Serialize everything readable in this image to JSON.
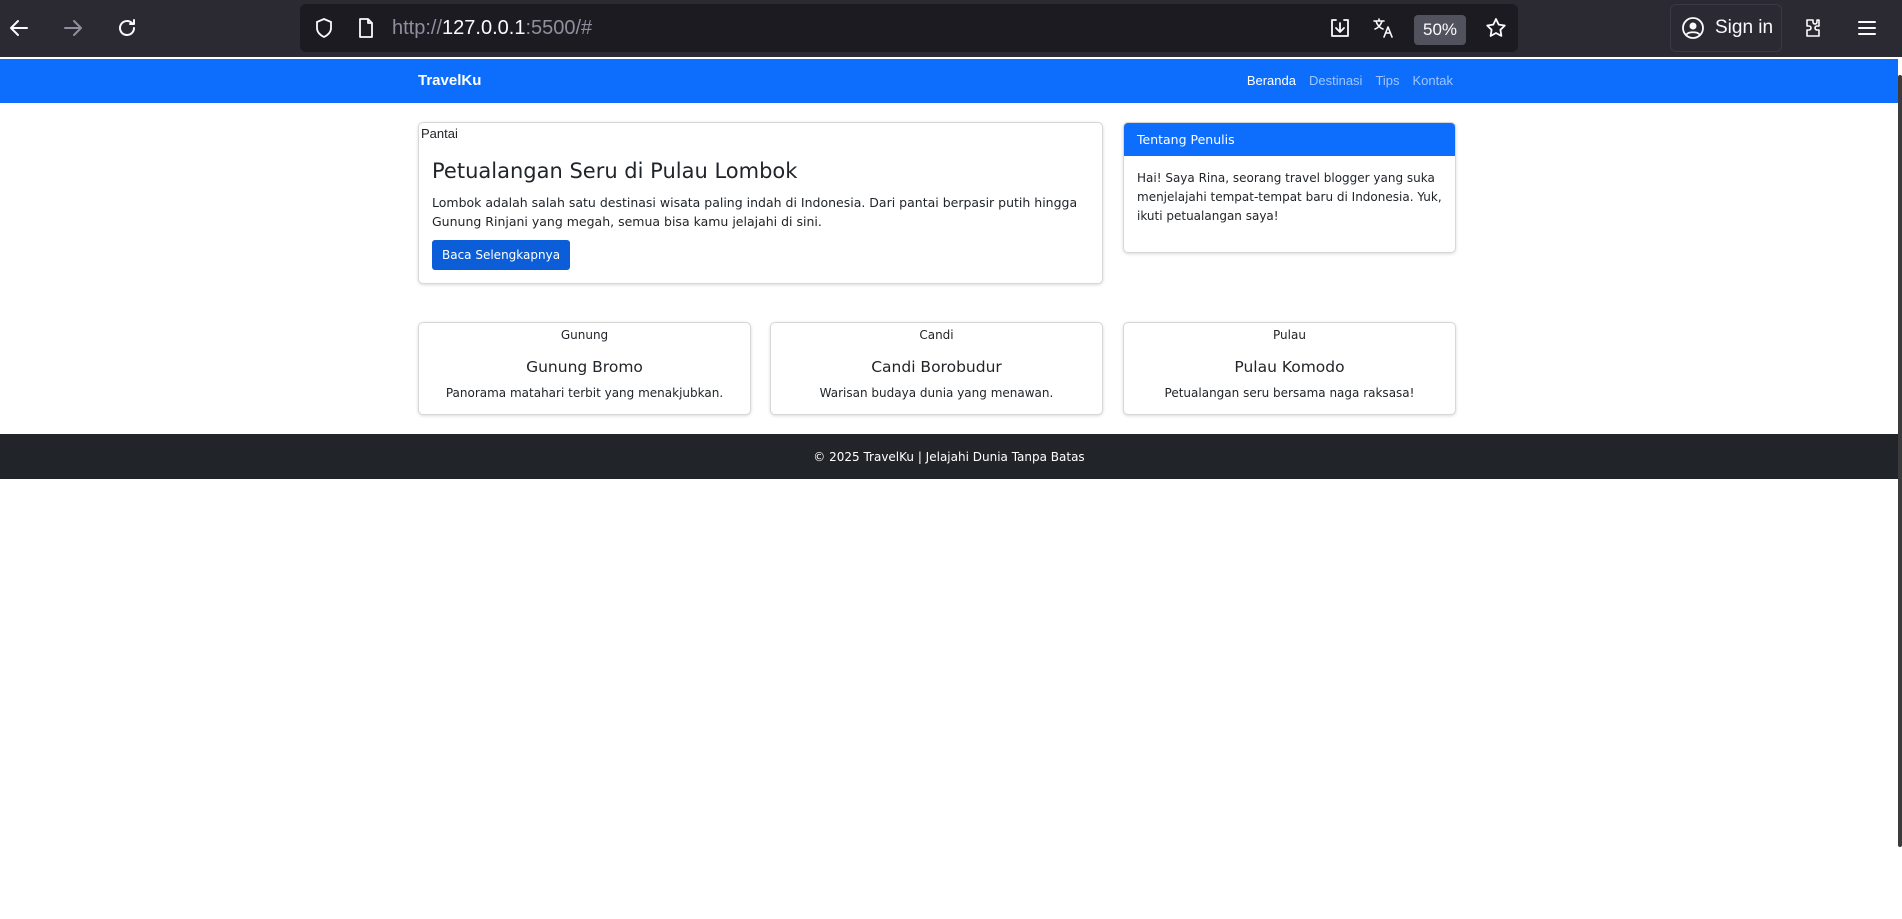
{
  "browser": {
    "url_prefix": "http://",
    "url_host": "127.0.0.1",
    "url_suffix": ":5500/#",
    "zoom": "50%",
    "signin_label": "Sign in"
  },
  "site": {
    "brand": "TravelKu",
    "nav": [
      {
        "label": "Beranda",
        "active": true
      },
      {
        "label": "Destinasi",
        "active": false
      },
      {
        "label": "Tips",
        "active": false
      },
      {
        "label": "Kontak",
        "active": false
      }
    ]
  },
  "featured": {
    "image_alt": "Pantai",
    "title": "Petualangan Seru di Pulau Lombok",
    "text": "Lombok adalah salah satu destinasi wisata paling indah di Indonesia. Dari pantai berpasir putih hingga Gunung Rinjani yang megah, semua bisa kamu jelajahi di sini.",
    "button": "Baca Selengkapnya"
  },
  "author": {
    "header": "Tentang Penulis",
    "text": "Hai! Saya Rina, seorang travel blogger yang suka menjelajahi tempat-tempat baru di Indonesia. Yuk, ikuti petualangan saya!"
  },
  "destinations": [
    {
      "image_alt": "Gunung",
      "title": "Gunung Bromo",
      "text": "Panorama matahari terbit yang menakjubkan."
    },
    {
      "image_alt": "Candi",
      "title": "Candi Borobudur",
      "text": "Warisan budaya dunia yang menawan."
    },
    {
      "image_alt": "Pulau",
      "title": "Pulau Komodo",
      "text": "Petualangan seru bersama naga raksasa!"
    }
  ],
  "footer": {
    "text": "© 2025 TravelKu | Jelajahi Dunia Tanpa Batas"
  }
}
